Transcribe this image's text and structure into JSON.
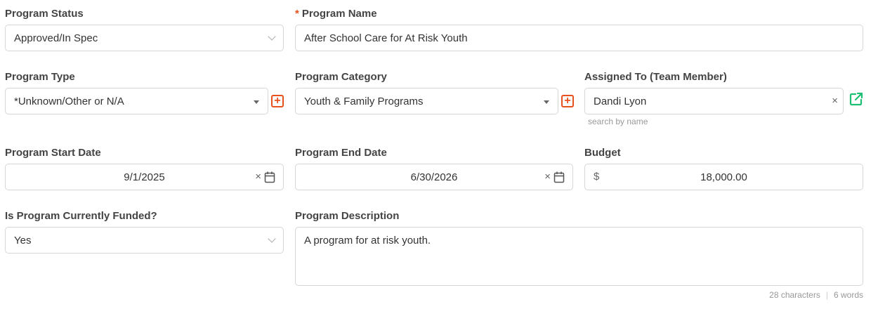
{
  "program_status": {
    "label": "Program Status",
    "value": "Approved/In Spec"
  },
  "program_name": {
    "required_mark": "*",
    "label": "Program Name",
    "value": "After School Care for At Risk Youth"
  },
  "program_type": {
    "label": "Program Type",
    "value": "*Unknown/Other or N/A"
  },
  "program_category": {
    "label": "Program Category",
    "value": "Youth & Family Programs"
  },
  "assigned_to": {
    "label": "Assigned To (Team Member)",
    "value": "Dandi Lyon",
    "hint": "search by name",
    "clear": "×"
  },
  "start_date": {
    "label": "Program Start Date",
    "value": "9/1/2025",
    "clear": "×"
  },
  "end_date": {
    "label": "Program End Date",
    "value": "6/30/2026",
    "clear": "×"
  },
  "budget": {
    "label": "Budget",
    "currency": "$",
    "value": "18,000.00"
  },
  "funded": {
    "label": "Is Program Currently Funded?",
    "value": "Yes"
  },
  "description": {
    "label": "Program Description",
    "value": "A program for at risk youth.",
    "char_count": "28 characters",
    "separator": "|",
    "word_count": "6 words"
  },
  "colors": {
    "accent_orange": "#e8501c",
    "accent_green": "#1dbf73",
    "border": "#d6d6d6"
  },
  "icons": {
    "add": "plus-square-icon",
    "external": "external-link-icon",
    "calendar": "calendar-icon"
  }
}
